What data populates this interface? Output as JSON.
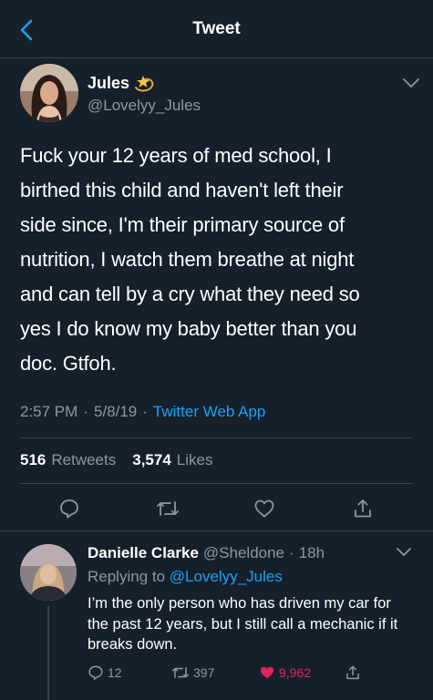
{
  "header": {
    "title": "Tweet"
  },
  "tweet": {
    "author_name": "Jules",
    "author_handle": "@Lovelyy_Jules",
    "text": "Fuck your 12 years of med school, I\nbirthed this child and haven't left their\nside since, I'm their primary source of\nnutrition, I watch them breathe at night\nand can tell by a cry what they need so\nyes I do know my baby better than you\ndoc. Gtfoh.",
    "time": "2:57 PM",
    "date": "5/8/19",
    "separator": "·",
    "source": "Twitter Web App",
    "retweets_count": "516",
    "retweets_label": "Retweets",
    "likes_count": "3,574",
    "likes_label": "Likes"
  },
  "reply": {
    "author_name": "Danielle Clarke",
    "author_handle": "@Sheldone",
    "separator": "·",
    "time": "18h",
    "replying_prefix": "Replying to",
    "replying_to": "@Lovelyy_Jules",
    "text": "I’m the only person who has driven my car for the past 12 years, but I still call a mechanic if it breaks down.",
    "replies": "12",
    "retweets": "397",
    "likes": "9,962"
  },
  "colors": {
    "background": "#15202b",
    "accent": "#1da1f2",
    "secondary_text": "#8899a6",
    "like": "#e0245e"
  }
}
